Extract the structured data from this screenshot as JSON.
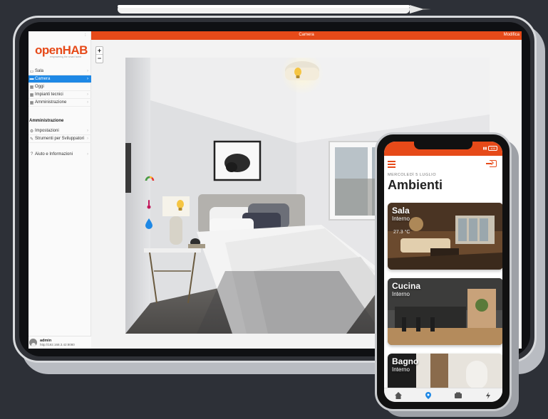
{
  "app": {
    "brand": "openHAB",
    "brand_tagline": "empowering the smart home"
  },
  "sidebar": {
    "toggle_icon": "dots-icon",
    "items": [
      {
        "label": "Sala",
        "icon": "sofa-icon",
        "active": false
      },
      {
        "label": "Camera",
        "icon": "bed-icon",
        "active": true
      },
      {
        "label": "Oggi",
        "icon": "calendar-icon",
        "active": false
      },
      {
        "label": "Impianti tecnici",
        "icon": "grid-icon",
        "active": false
      },
      {
        "label": "Amministrazione",
        "icon": "grid-icon",
        "active": false
      }
    ],
    "section_title": "Amministrazione",
    "admin_items": [
      {
        "label": "Impostazioni",
        "icon": "gear-icon"
      },
      {
        "label": "Strumenti per Sviluppatori",
        "icon": "wrench-icon"
      },
      {
        "label": "Aiuto e Informazioni",
        "icon": "help-icon"
      }
    ],
    "user": {
      "name": "admin",
      "url": "http://192.168.3.42:8080"
    }
  },
  "topbar": {
    "title": "Camera",
    "edit_label": "Modifica",
    "color": "#e64a19"
  },
  "content": {
    "zoom_in": "+",
    "zoom_out": "−",
    "markers": [
      "bulb-icon",
      "gauge-icon",
      "thermometer-icon",
      "water-drop-icon"
    ]
  },
  "phone": {
    "status": {
      "battery": "100"
    },
    "date": "MERCOLEDÌ 5 LUGLIO",
    "title": "Ambienti",
    "cards": [
      {
        "name": "Sala",
        "subtitle": "Interno",
        "temperature": "27.3 °C"
      },
      {
        "name": "Cucina",
        "subtitle": "Interno"
      },
      {
        "name": "Bagno",
        "subtitle": "Interno"
      }
    ],
    "tabs": [
      "home-icon",
      "location-pin-icon",
      "media-icon",
      "bolt-icon"
    ],
    "accent": "#e64a19",
    "active_tab": "#1e88e5"
  }
}
